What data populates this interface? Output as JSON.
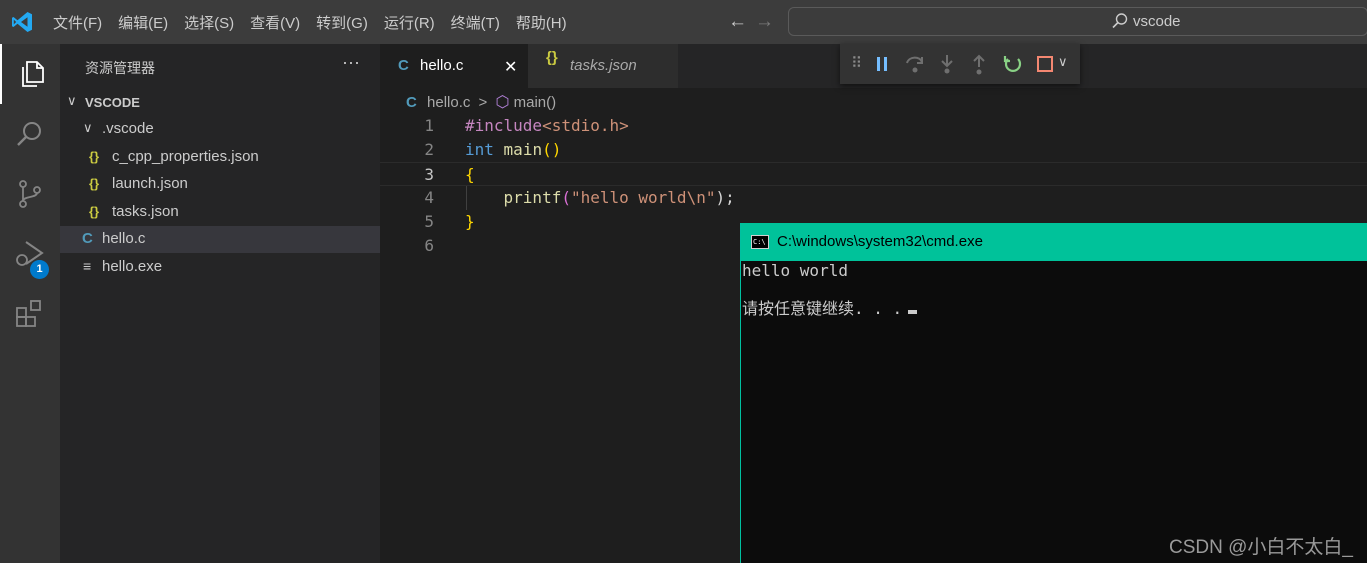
{
  "menu": [
    "文件(F)",
    "编辑(E)",
    "选择(S)",
    "查看(V)",
    "转到(G)",
    "运行(R)",
    "终端(T)",
    "帮助(H)"
  ],
  "search": {
    "text": "vscode"
  },
  "activity": {
    "debug_badge": "1"
  },
  "sidebar": {
    "title": "资源管理器",
    "more": "···",
    "root": "VSCODE",
    "folder": ".vscode",
    "files": {
      "c_cpp": "c_cpp_properties.json",
      "launch": "launch.json",
      "tasks": "tasks.json",
      "hello_c": "hello.c",
      "hello_exe": "hello.exe"
    },
    "json_icon": "{}",
    "c_icon": "C",
    "exe_icon": "≡"
  },
  "tabs": {
    "active": {
      "icon": "C",
      "label": "hello.c",
      "close": "✕"
    },
    "inactive": {
      "icon": "{}",
      "label": "tasks.json"
    }
  },
  "breadcrumb": {
    "file": "hello.c",
    "sep": ">",
    "symbol": "main()"
  },
  "editor": {
    "lines": [
      "1",
      "2",
      "3",
      "4",
      "5",
      "6"
    ],
    "l1": {
      "pre": "#include",
      "hdr": "<stdio.h>"
    },
    "l2": {
      "kw": "int",
      "fn": "main",
      "paren": "()"
    },
    "l3": {
      "brace": "{"
    },
    "l4": {
      "fn": "printf",
      "open": "(",
      "str": "\"hello world\\n\"",
      "close": ");"
    },
    "l5": {
      "brace": "}"
    }
  },
  "cmd": {
    "title": "C:\\windows\\system32\\cmd.exe",
    "icon_text": "C:\\",
    "output1": "hello world",
    "output2": "请按任意键继续. . ."
  },
  "watermark": "CSDN @小白不太白_",
  "colors": {
    "titlebar": "#3c3c3c",
    "activity": "#333333",
    "sidebar": "#252526",
    "editor": "#1e1e1e",
    "accent": "#007acc",
    "cmd_title": "#00c29a"
  }
}
